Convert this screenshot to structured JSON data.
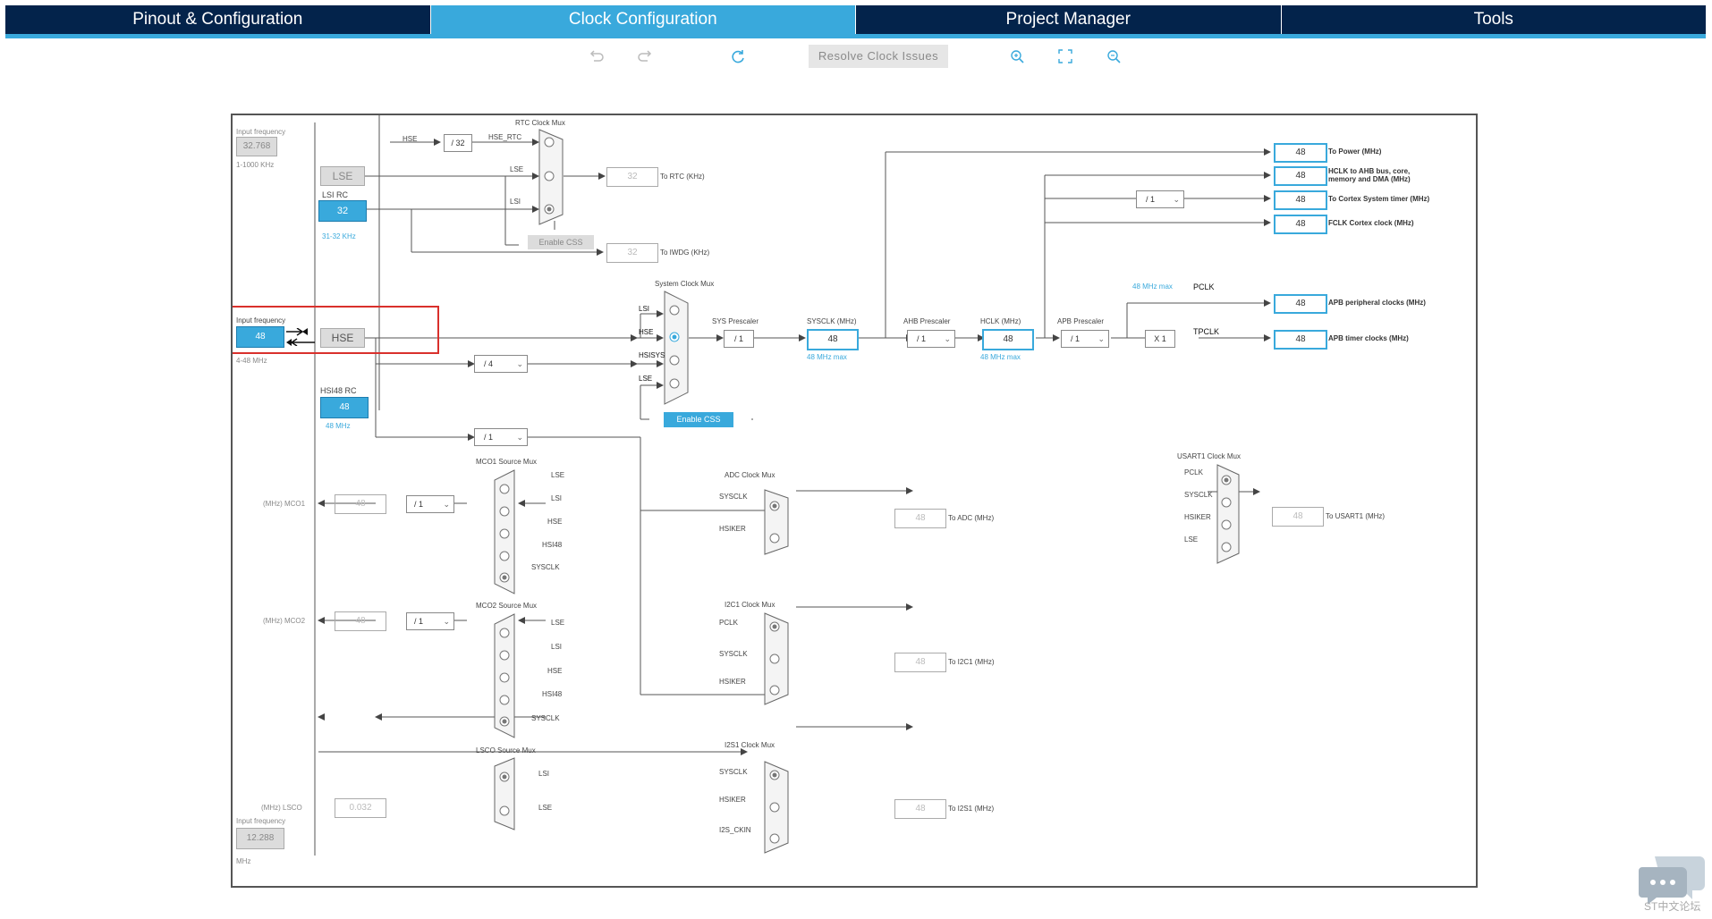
{
  "tabs": [
    {
      "label": "Pinout & Configuration",
      "active": false
    },
    {
      "label": "Clock Configuration",
      "active": true
    },
    {
      "label": "Project Manager",
      "active": false
    },
    {
      "label": "Tools",
      "active": false
    }
  ],
  "toolbar": {
    "resolve_label": "Resolve Clock Issues",
    "icons": [
      "undo-icon",
      "redo-icon",
      "refresh-icon",
      "zoom-in-icon",
      "fit-screen-icon",
      "zoom-out-icon"
    ]
  },
  "colors": {
    "accent": "#39a9dc",
    "navy": "#03234b",
    "highlight": "#d9302c"
  },
  "clock": {
    "lse_input_label": "Input frequency",
    "lse_input_value": "32.768",
    "lse_range": "1-1000 KHz",
    "lse_label": "LSE",
    "lsi_rc_label": "LSI RC",
    "lsi_value": "32",
    "lsi_range": "31-32 KHz",
    "rtc_mux_title": "RTC Clock Mux",
    "hse_label_small": "HSE",
    "div32": "/ 32",
    "hse_rtc": "HSE_RTC",
    "lse_small": "LSE",
    "lsi_small": "LSI",
    "rtc_value": "32",
    "rtc_out": "To RTC (KHz)",
    "enable_css": "Enable CSS",
    "iwdg_value": "32",
    "iwdg_out": "To IWDG (KHz)",
    "hse_input_label": "Input frequency",
    "hse_input_value": "48",
    "hse_range": "4-48 MHz",
    "hse_label": "HSE",
    "div4": "/ 4",
    "hsi48_label": "HSI48 RC",
    "hsi48_value": "48",
    "hsi48_unit": "48 MHz",
    "div1_hsi": "/ 1",
    "sys_mux_title": "System Clock Mux",
    "sys_mux_inputs": [
      "LSI",
      "HSE",
      "HSISYS",
      "LSE"
    ],
    "enable_css2": "Enable CSS",
    "sys_prescaler_label": "SYS Prescaler",
    "sys_prescaler_value": "/ 1",
    "sysclk_label": "SYSCLK (MHz)",
    "sysclk_value": "48",
    "sysclk_max": "48 MHz max",
    "ahb_label": "AHB Prescaler",
    "ahb_value": "/ 1",
    "hclk_label": "HCLK (MHz)",
    "hclk_value": "48",
    "hclk_max": "48 MHz max",
    "apb_label": "APB Prescaler",
    "apb_value": "/ 1",
    "apb_max": "48 MHz max",
    "pclk": "PCLK",
    "tpclk": "TPCLK",
    "x1": "X 1",
    "cortex_div": "/ 1",
    "outputs": [
      {
        "value": "48",
        "label": "To Power (MHz)"
      },
      {
        "value": "48",
        "label": "HCLK to AHB bus, core, memory and DMA (MHz)"
      },
      {
        "value": "48",
        "label": "To Cortex System timer (MHz)"
      },
      {
        "value": "48",
        "label": "FCLK Cortex clock (MHz)"
      },
      {
        "value": "48",
        "label": "APB peripheral clocks (MHz)"
      },
      {
        "value": "48",
        "label": "APB timer clocks (MHz)"
      }
    ],
    "mco1_title": "MCO1 Source Mux",
    "mco1_inputs": [
      "LSE",
      "LSI",
      "HSE",
      "HSI48",
      "SYSCLK"
    ],
    "mco1_label": "(MHz) MCO1",
    "mco1_value": "48",
    "mco1_div": "/ 1",
    "mco2_title": "MCO2 Source Mux",
    "mco2_inputs": [
      "LSE",
      "LSI",
      "HSE",
      "HSI48",
      "SYSCLK"
    ],
    "mco2_label": "(MHz) MCO2",
    "mco2_value": "48",
    "mco2_div": "/ 1",
    "lsco_title": "LSCO Source Mux",
    "lsco_inputs": [
      "LSI",
      "LSE"
    ],
    "lsco_label": "(MHz) LSCO",
    "lsco_value": "0.032",
    "i2s_input_label": "Input frequency",
    "i2s_input_value": "12.288",
    "i2s_input_unit": "MHz",
    "adc_title": "ADC Clock Mux",
    "adc_inputs": [
      "SYSCLK",
      "HSIKER"
    ],
    "adc_value": "48",
    "adc_out": "To ADC (MHz)",
    "i2c1_title": "I2C1 Clock Mux",
    "i2c1_inputs": [
      "PCLK",
      "SYSCLK",
      "HSIKER"
    ],
    "i2c1_value": "48",
    "i2c1_out": "To I2C1 (MHz)",
    "i2s1_title": "I2S1 Clock Mux",
    "i2s1_inputs": [
      "SYSCLK",
      "HSIKER",
      "I2S_CKIN"
    ],
    "i2s1_value": "48",
    "i2s1_out": "To I2S1 (MHz)",
    "usart1_title": "USART1 Clock Mux",
    "usart1_inputs": [
      "PCLK",
      "SYSCLK",
      "HSIKER",
      "LSE"
    ],
    "usart1_value": "48",
    "usart1_out": "To USART1 (MHz)"
  },
  "watermark": "ST中文论坛"
}
